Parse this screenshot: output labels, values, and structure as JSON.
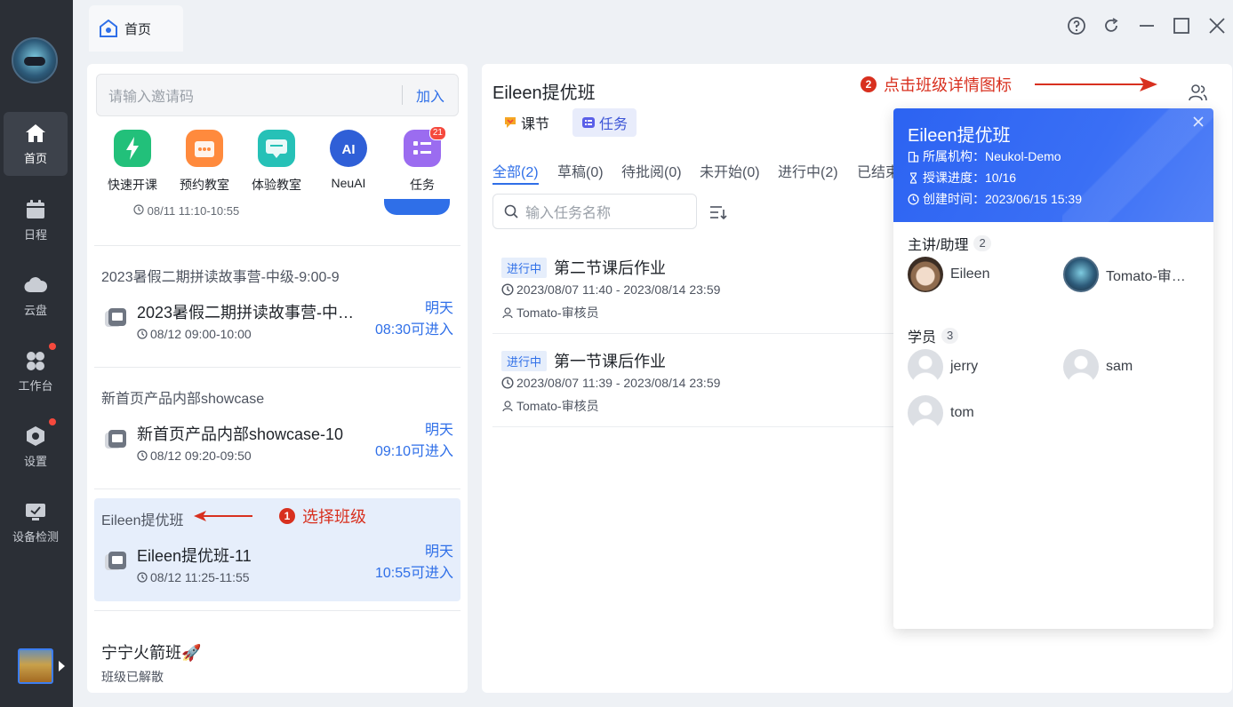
{
  "sidebar": {
    "items": [
      {
        "label": "首页",
        "icon": "home-icon"
      },
      {
        "label": "日程",
        "icon": "calendar-icon"
      },
      {
        "label": "云盘",
        "icon": "cloud-icon"
      },
      {
        "label": "工作台",
        "icon": "workbench-icon"
      },
      {
        "label": "设置",
        "icon": "settings-icon"
      },
      {
        "label": "设备检测",
        "icon": "device-check-icon"
      }
    ]
  },
  "topbar": {
    "tab_label": "首页"
  },
  "invite": {
    "placeholder": "请输入邀请码",
    "join_label": "加入"
  },
  "quick_actions": [
    {
      "label": "快速开课",
      "icon": "lightning-icon",
      "color": "#22c07a"
    },
    {
      "label": "预约教室",
      "icon": "calendar-book-icon",
      "color": "#ff8a3d"
    },
    {
      "label": "体验教室",
      "icon": "chat-icon",
      "color": "#26c1b7"
    },
    {
      "label": "NeuAI",
      "icon": "ai-icon",
      "color": "#2f5fd7"
    },
    {
      "label": "任务",
      "icon": "task-list-icon",
      "color": "#9b6cf0",
      "badge": "21"
    }
  ],
  "lessons_list": {
    "cut_time": "08/11 11:10-10:55",
    "groups": [
      {
        "title": "2023暑假二期拼读故事营-中级-9:00-9",
        "lesson_name": "2023暑假二期拼读故事营-中级-9:00-9",
        "time": "08/12 09:00-10:00",
        "when_line1": "明天",
        "when_line2": "08:30可进入"
      },
      {
        "title": "新首页产品内部showcase",
        "lesson_name": "新首页产品内部showcase-10",
        "time": "08/12 09:20-09:50",
        "when_line1": "明天",
        "when_line2": "09:10可进入"
      },
      {
        "title": "Eileen提优班",
        "lesson_name": "Eileen提优班-11",
        "time": "08/12 11:25-11:55",
        "when_line1": "明天",
        "when_line2": "10:55可进入"
      }
    ],
    "disbanded": {
      "title": "宁宁火箭班🚀",
      "status": "班级已解散"
    }
  },
  "annotations": {
    "step1_num": "1",
    "step1_text": "选择班级",
    "step2_num": "2",
    "step2_text": "点击班级详情图标",
    "color": "#d8301f"
  },
  "class_detail": {
    "title": "Eileen提优班",
    "tabs": [
      "课节",
      "任务"
    ],
    "filters": [
      "全部(2)",
      "草稿(0)",
      "待批阅(0)",
      "未开始(0)",
      "进行中(2)",
      "已结束"
    ],
    "search_placeholder": "输入任务名称",
    "tasks": [
      {
        "status": "进行中",
        "title": "第二节课后作业",
        "time": "2023/08/07 11:40 - 2023/08/14 23:59",
        "owner": "Tomato-审核员"
      },
      {
        "status": "进行中",
        "title": "第一节课后作业",
        "time": "2023/08/07 11:39 - 2023/08/14 23:59",
        "owner": "Tomato-审核员"
      }
    ]
  },
  "popup": {
    "title": "Eileen提优班",
    "org": "所属机构：Neukol-Demo",
    "progress": "授课进度：10/16",
    "created": "创建时间：2023/06/15 15:39",
    "teachers_label": "主讲/助理",
    "teachers_count": "2",
    "teachers": [
      "Eileen",
      "Tomato-审…"
    ],
    "students_label": "学员",
    "students_count": "3",
    "students": [
      "jerry",
      "sam",
      "tom"
    ]
  }
}
